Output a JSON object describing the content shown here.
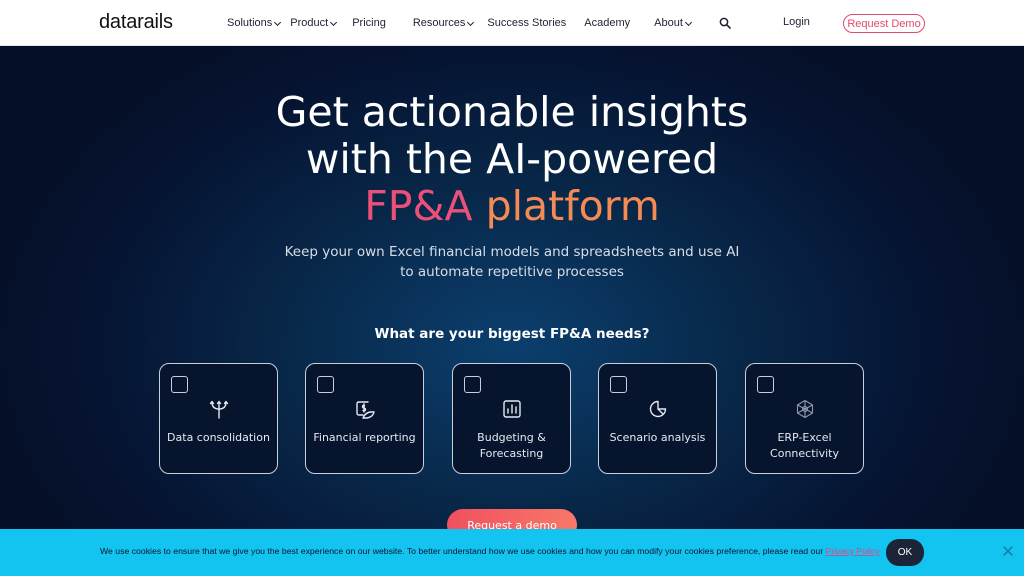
{
  "nav": {
    "logo": "datarails",
    "items": [
      {
        "label": "Solutions",
        "has_dropdown": true
      },
      {
        "label": "Product",
        "has_dropdown": true
      },
      {
        "label": "Pricing",
        "has_dropdown": false
      },
      {
        "label": "Resources",
        "has_dropdown": true
      },
      {
        "label": "Success Stories",
        "has_dropdown": false
      },
      {
        "label": "Academy",
        "has_dropdown": false
      },
      {
        "label": "About",
        "has_dropdown": true
      }
    ],
    "login": "Login",
    "request_demo": "Request Demo"
  },
  "hero": {
    "headline_line1": "Get actionable insights",
    "headline_line2": "with the AI-powered",
    "headline_line3a": "FP&A",
    "headline_line3b": "platform",
    "subtitle_line1": "Keep your own Excel financial models and spreadsheets and use AI",
    "subtitle_line2": "to automate repetitive processes",
    "question": "What are your biggest FP&A needs?",
    "cards": [
      {
        "label": "Data consolidation",
        "icon": "merge-arrows-icon",
        "checked": false
      },
      {
        "label": "Financial reporting",
        "icon": "dollar-report-icon",
        "checked": false
      },
      {
        "label": "Budgeting & Forecasting",
        "icon": "bar-chart-icon",
        "checked": false
      },
      {
        "label": "Scenario analysis",
        "icon": "pie-chart-icon",
        "checked": false
      },
      {
        "label": "ERP-Excel Connectivity",
        "icon": "network-icon",
        "checked": false
      }
    ],
    "cta": "Request a demo"
  },
  "cookie": {
    "text": "We use cookies to ensure that we give you the best experience on our website. To better understand how we use cookies and how you can modify your cookies preference, please read our",
    "link": "Privacy Policy",
    "ok": "OK"
  },
  "colors": {
    "accent_pink": "#ec4f78",
    "accent_orange": "#f58a55",
    "cookie_bar": "#12c4ef"
  }
}
